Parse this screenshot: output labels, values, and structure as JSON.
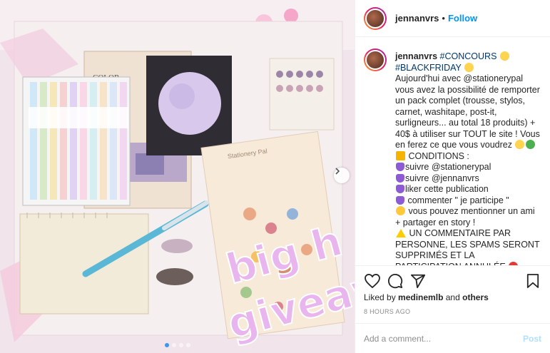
{
  "post_image": {
    "sign_text": "big h",
    "sign_text2": "giveaw",
    "book_label": "COLOR",
    "card_label": "Stationery Pal",
    "carousel_dots": 4,
    "active_dot": 1
  },
  "header": {
    "username": "jennanvrs",
    "separator": "•",
    "follow_label": "Follow"
  },
  "caption": {
    "username": "jennanvrs",
    "lines": [
      "#CONCOURS",
      "#BLACKFRIDAY",
      "Aujourd'hui avec @stationerypal vous avez la possibilité de remporter un pack complet (trousse, stylos, carnet, washitape, post-it, surligneurs... au total 18 produits) + 40$ à utiliser sur TOUT le site ! Vous en ferez ce que vous voudrez",
      "CONDITIONS :",
      "suivre @stationerypal",
      "suivre @jennanvrs",
      "liker cette publication",
      "commenter \" je participe \"",
      "vous pouvez mentionner un ami + partager en story !",
      "UN COMMENTAIRE PAR PERSONNE, LES SPAMS SERONT SUPPRIMÉS ET LA PARTICIPATION ANNULÉE"
    ]
  },
  "likes": {
    "prefix": "Liked by",
    "user": "medinemlb",
    "joiner": "and",
    "others": "others"
  },
  "timestamp": "8 HOURS AGO",
  "comment": {
    "placeholder": "Add a comment...",
    "post_label": "Post"
  },
  "icons": [
    "heart-icon",
    "comment-icon",
    "share-icon",
    "bookmark-icon",
    "chevron-right-icon"
  ],
  "colors": {
    "link": "#00376b",
    "follow": "#0095f6",
    "post_disabled": "#b2dffc",
    "active_dot": "#3897f0"
  }
}
